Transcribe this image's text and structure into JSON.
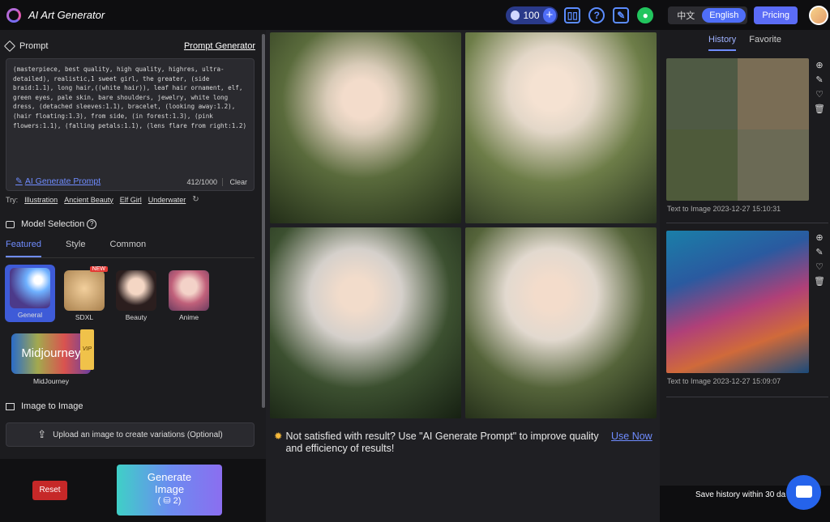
{
  "app": {
    "title": "AI Art Generator"
  },
  "header": {
    "credits": "100",
    "lang_zh": "中文",
    "lang_en": "English",
    "pricing": "Pricing"
  },
  "prompt": {
    "title": "Prompt",
    "generator_link": "Prompt Generator",
    "text": "(masterpiece, best quality, high quality, highres, ultra-detailed), realistic,1 sweet girl, the greater, (side braid:1.1), long hair,((white hair)), leaf hair ornament, elf, green eyes, pale skin, bare shoulders, jewelry, white long dress, (detached sleeves:1.1), bracelet, (looking away:1.2), (hair floating:1.3), from side, (in forest:1.3), (pink flowers:1.1), (falling petals:1.1), (lens flare from right:1.2)",
    "ai_generate": "AI Generate Prompt",
    "count": "412/1000",
    "clear": "Clear",
    "try_label": "Try:",
    "try_items": [
      "Illustration",
      "Ancient Beauty",
      "Elf Girl",
      "Underwater"
    ]
  },
  "models": {
    "title": "Model Selection",
    "tabs": [
      "Featured",
      "Style",
      "Common"
    ],
    "items": [
      {
        "label": "General"
      },
      {
        "label": "SDXL",
        "badge": "NEW"
      },
      {
        "label": "Beauty"
      },
      {
        "label": "Anime"
      },
      {
        "label": "MidJourney",
        "badge": "VIP",
        "overlay": "Midjourney"
      }
    ]
  },
  "image_to_image": {
    "title": "Image to Image",
    "upload_label": "Upload an image to create variations (Optional)"
  },
  "actions": {
    "reset": "Reset",
    "generate_line1": "Generate",
    "generate_line2": "Image",
    "generate_cost": "2"
  },
  "notice": {
    "text": "Not satisfied with result? Use \"AI Generate Prompt\" to improve quality and efficiency of results!",
    "use_now": "Use Now"
  },
  "history": {
    "tabs": [
      "History",
      "Favorite"
    ],
    "entries": [
      {
        "caption": "Text to Image 2023-12-27 15:10:31"
      },
      {
        "caption": "Text to Image 2023-12-27 15:09:07"
      }
    ],
    "save_note": "Save history within 30 da"
  }
}
